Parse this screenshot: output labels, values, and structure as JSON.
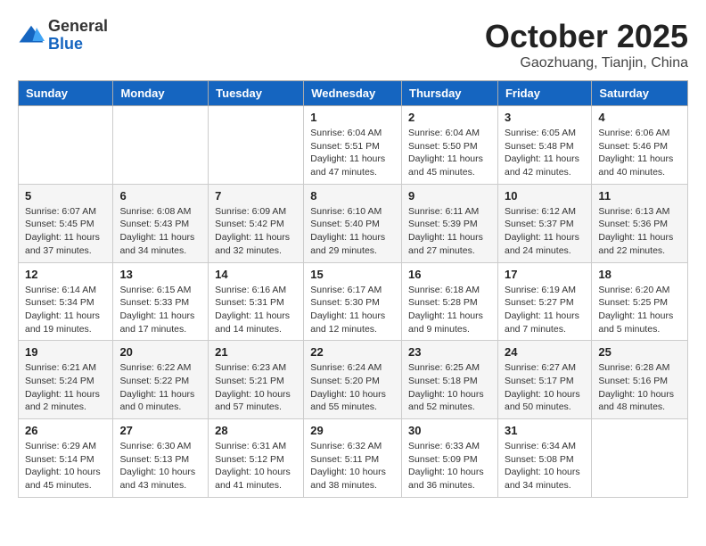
{
  "header": {
    "logo": {
      "general": "General",
      "blue": "Blue"
    },
    "title": "October 2025",
    "location": "Gaozhuang, Tianjin, China"
  },
  "weekdays": [
    "Sunday",
    "Monday",
    "Tuesday",
    "Wednesday",
    "Thursday",
    "Friday",
    "Saturday"
  ],
  "weeks": [
    [
      {
        "day": "",
        "info": ""
      },
      {
        "day": "",
        "info": ""
      },
      {
        "day": "",
        "info": ""
      },
      {
        "day": "1",
        "info": "Sunrise: 6:04 AM\nSunset: 5:51 PM\nDaylight: 11 hours and 47 minutes."
      },
      {
        "day": "2",
        "info": "Sunrise: 6:04 AM\nSunset: 5:50 PM\nDaylight: 11 hours and 45 minutes."
      },
      {
        "day": "3",
        "info": "Sunrise: 6:05 AM\nSunset: 5:48 PM\nDaylight: 11 hours and 42 minutes."
      },
      {
        "day": "4",
        "info": "Sunrise: 6:06 AM\nSunset: 5:46 PM\nDaylight: 11 hours and 40 minutes."
      }
    ],
    [
      {
        "day": "5",
        "info": "Sunrise: 6:07 AM\nSunset: 5:45 PM\nDaylight: 11 hours and 37 minutes."
      },
      {
        "day": "6",
        "info": "Sunrise: 6:08 AM\nSunset: 5:43 PM\nDaylight: 11 hours and 34 minutes."
      },
      {
        "day": "7",
        "info": "Sunrise: 6:09 AM\nSunset: 5:42 PM\nDaylight: 11 hours and 32 minutes."
      },
      {
        "day": "8",
        "info": "Sunrise: 6:10 AM\nSunset: 5:40 PM\nDaylight: 11 hours and 29 minutes."
      },
      {
        "day": "9",
        "info": "Sunrise: 6:11 AM\nSunset: 5:39 PM\nDaylight: 11 hours and 27 minutes."
      },
      {
        "day": "10",
        "info": "Sunrise: 6:12 AM\nSunset: 5:37 PM\nDaylight: 11 hours and 24 minutes."
      },
      {
        "day": "11",
        "info": "Sunrise: 6:13 AM\nSunset: 5:36 PM\nDaylight: 11 hours and 22 minutes."
      }
    ],
    [
      {
        "day": "12",
        "info": "Sunrise: 6:14 AM\nSunset: 5:34 PM\nDaylight: 11 hours and 19 minutes."
      },
      {
        "day": "13",
        "info": "Sunrise: 6:15 AM\nSunset: 5:33 PM\nDaylight: 11 hours and 17 minutes."
      },
      {
        "day": "14",
        "info": "Sunrise: 6:16 AM\nSunset: 5:31 PM\nDaylight: 11 hours and 14 minutes."
      },
      {
        "day": "15",
        "info": "Sunrise: 6:17 AM\nSunset: 5:30 PM\nDaylight: 11 hours and 12 minutes."
      },
      {
        "day": "16",
        "info": "Sunrise: 6:18 AM\nSunset: 5:28 PM\nDaylight: 11 hours and 9 minutes."
      },
      {
        "day": "17",
        "info": "Sunrise: 6:19 AM\nSunset: 5:27 PM\nDaylight: 11 hours and 7 minutes."
      },
      {
        "day": "18",
        "info": "Sunrise: 6:20 AM\nSunset: 5:25 PM\nDaylight: 11 hours and 5 minutes."
      }
    ],
    [
      {
        "day": "19",
        "info": "Sunrise: 6:21 AM\nSunset: 5:24 PM\nDaylight: 11 hours and 2 minutes."
      },
      {
        "day": "20",
        "info": "Sunrise: 6:22 AM\nSunset: 5:22 PM\nDaylight: 11 hours and 0 minutes."
      },
      {
        "day": "21",
        "info": "Sunrise: 6:23 AM\nSunset: 5:21 PM\nDaylight: 10 hours and 57 minutes."
      },
      {
        "day": "22",
        "info": "Sunrise: 6:24 AM\nSunset: 5:20 PM\nDaylight: 10 hours and 55 minutes."
      },
      {
        "day": "23",
        "info": "Sunrise: 6:25 AM\nSunset: 5:18 PM\nDaylight: 10 hours and 52 minutes."
      },
      {
        "day": "24",
        "info": "Sunrise: 6:27 AM\nSunset: 5:17 PM\nDaylight: 10 hours and 50 minutes."
      },
      {
        "day": "25",
        "info": "Sunrise: 6:28 AM\nSunset: 5:16 PM\nDaylight: 10 hours and 48 minutes."
      }
    ],
    [
      {
        "day": "26",
        "info": "Sunrise: 6:29 AM\nSunset: 5:14 PM\nDaylight: 10 hours and 45 minutes."
      },
      {
        "day": "27",
        "info": "Sunrise: 6:30 AM\nSunset: 5:13 PM\nDaylight: 10 hours and 43 minutes."
      },
      {
        "day": "28",
        "info": "Sunrise: 6:31 AM\nSunset: 5:12 PM\nDaylight: 10 hours and 41 minutes."
      },
      {
        "day": "29",
        "info": "Sunrise: 6:32 AM\nSunset: 5:11 PM\nDaylight: 10 hours and 38 minutes."
      },
      {
        "day": "30",
        "info": "Sunrise: 6:33 AM\nSunset: 5:09 PM\nDaylight: 10 hours and 36 minutes."
      },
      {
        "day": "31",
        "info": "Sunrise: 6:34 AM\nSunset: 5:08 PM\nDaylight: 10 hours and 34 minutes."
      },
      {
        "day": "",
        "info": ""
      }
    ]
  ]
}
